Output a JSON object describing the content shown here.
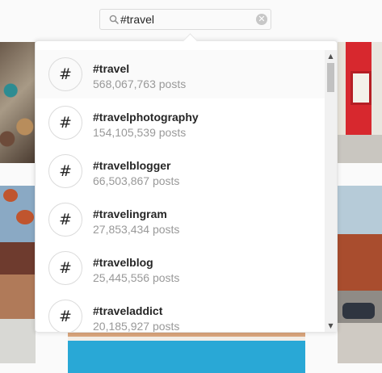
{
  "search": {
    "value": "#travel",
    "clear_glyph": "✕"
  },
  "icons": {
    "search": "search-icon",
    "clear": "clear-icon",
    "hashtag": "#",
    "scroll_up": "▲",
    "scroll_down": "▼"
  },
  "results": [
    {
      "tag": "#travel",
      "count": "568,067,763 posts"
    },
    {
      "tag": "#travelphotography",
      "count": "154,105,539 posts"
    },
    {
      "tag": "#travelblogger",
      "count": "66,503,867 posts"
    },
    {
      "tag": "#travelingram",
      "count": "27,853,434 posts"
    },
    {
      "tag": "#travelblog",
      "count": "25,445,556 posts"
    },
    {
      "tag": "#traveladdict",
      "count": "20,185,927 posts"
    }
  ],
  "colors": {
    "highlight": "#fafafa",
    "count_text": "#999999",
    "border": "#dbdbdb"
  }
}
